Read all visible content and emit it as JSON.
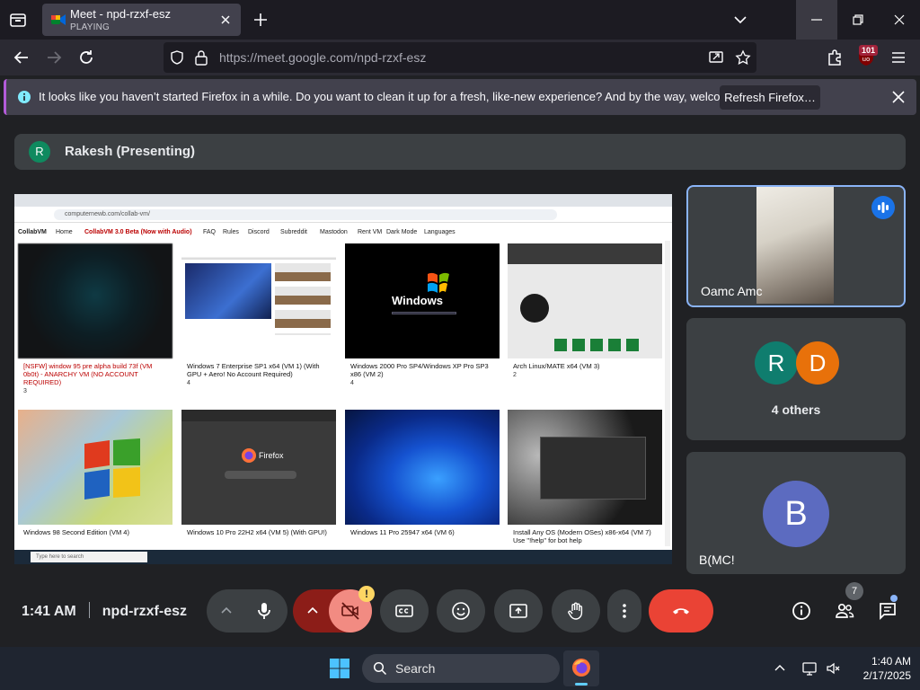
{
  "browser": {
    "tab": {
      "title": "Meet - npd-rzxf-esz",
      "status": "PLAYING"
    },
    "url": "https://meet.google.com/npd-rzxf-esz",
    "extension_badge": "101",
    "notification": {
      "message": "It looks like you haven’t started Firefox in a while. Do you want to clean it up for a fresh, like-new experience? And by the way, welcome back!",
      "button": "Refresh Firefox…"
    }
  },
  "meet": {
    "presenter": {
      "initial": "R",
      "label": "Rakesh (Presenting)"
    },
    "shared_screen": {
      "site_title": "CollabVM",
      "nav": [
        "Home",
        "CollabVM 3.0 Beta (Now with Audio)",
        "FAQ",
        "Rules",
        "Discord",
        "Subreddit",
        "Mastodon",
        "Rent VM",
        "Dark Mode",
        "Languages"
      ],
      "url": "computernewb.com/collab-vm/",
      "taskbar_search": "Type here to search",
      "vms": [
        {
          "caption": "[NSFW] window 95 pre alpha build 73f (VM 0b0t) - ANARCHY VM (NO ACCOUNT REQUIRED)",
          "users": "3"
        },
        {
          "caption": "Windows 7 Enterprise SP1 x64 (VM 1) (With GPU + Aero! No Account Required)",
          "users": "4"
        },
        {
          "caption": "Windows 2000 Pro SP4/Windows XP Pro SP3 x86 (VM 2)",
          "users": "4"
        },
        {
          "caption": "Arch Linux/MATE x64 (VM 3)",
          "users": "2"
        },
        {
          "caption": "Windows 98 Second Edition (VM 4)",
          "users": ""
        },
        {
          "caption": "Windows 10 Pro 22H2 x64 (VM 5) (With GPU!)",
          "users": ""
        },
        {
          "caption": "Windows 11 Pro 25947 x64 (VM 6)",
          "users": ""
        },
        {
          "caption": "Install Any OS (Modern OSes) x86-x64 (VM 7) Use \"!help\" for bot help",
          "users": ""
        }
      ]
    },
    "participants": [
      {
        "name": "Oamc Amc"
      },
      {
        "avatars": [
          "R",
          "D"
        ],
        "label": "4 others"
      },
      {
        "initial": "B",
        "name": "B(MC!"
      }
    ],
    "time": "1:41 AM",
    "meeting_code": "npd-rzxf-esz",
    "people_count": "7",
    "colors": {
      "end_call": "#ea4335",
      "mic_off_bg": "#8c1d18",
      "active_border": "#8ab4f8"
    }
  },
  "taskbar": {
    "search": "Search",
    "time": "1:40 AM",
    "date": "2/17/2025"
  }
}
